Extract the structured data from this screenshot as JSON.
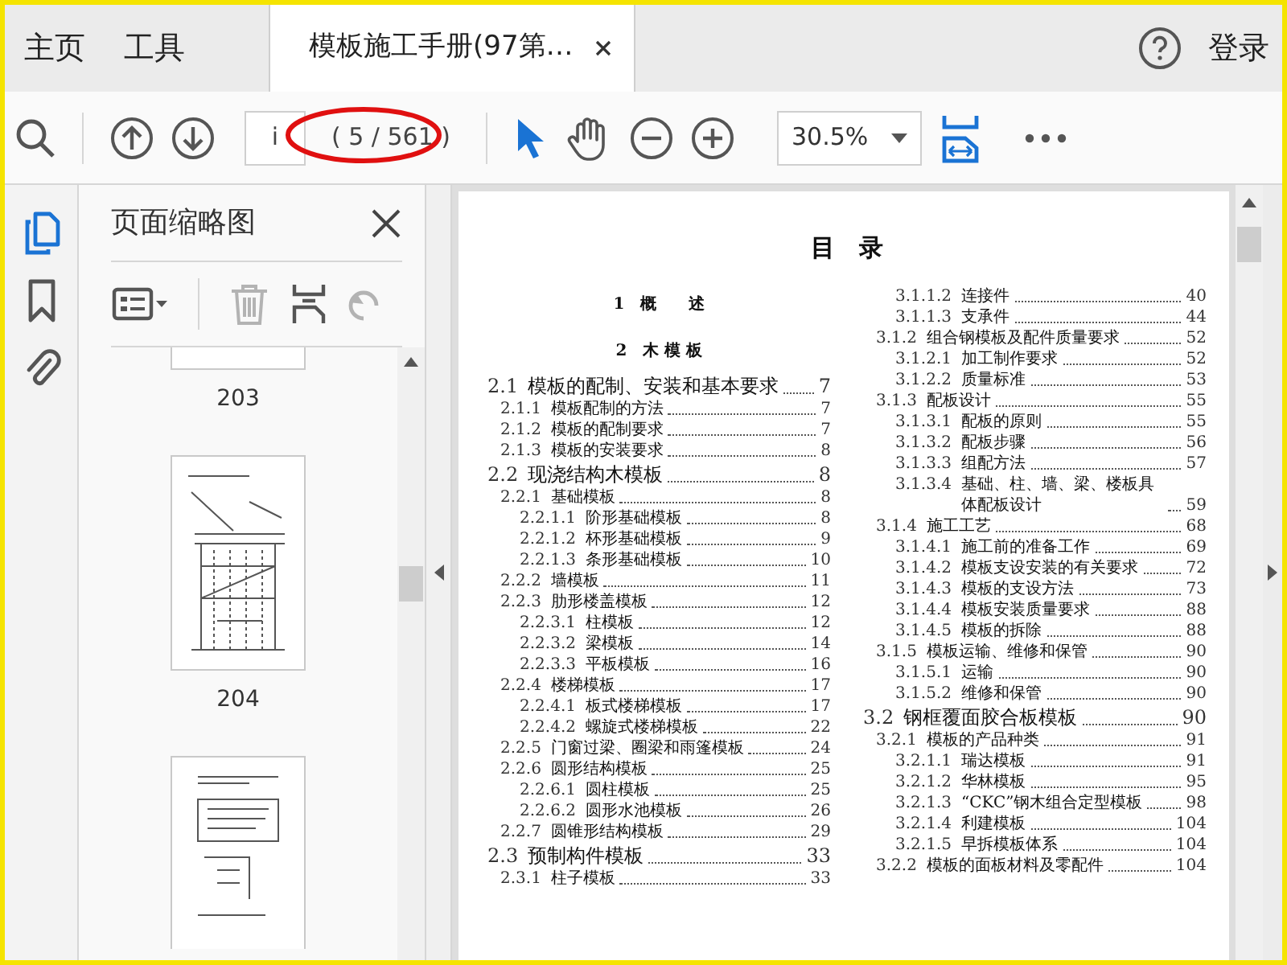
{
  "tabs": [
    {
      "label": "主页",
      "selected": false,
      "closable": false
    },
    {
      "label": "工具",
      "selected": false,
      "closable": false
    },
    {
      "label": "模板施工手册(97第…",
      "selected": true,
      "closable": true
    }
  ],
  "account": {
    "sign_in": "登录"
  },
  "toolbar": {
    "page_field": "i",
    "page_count": "( 5 / 561 )",
    "zoom": "30.5%",
    "tools": [
      {
        "kind": "select",
        "selected": true
      },
      {
        "kind": "hand",
        "selected": false
      }
    ]
  },
  "rail": [
    {
      "kind": "pages",
      "selected": true
    },
    {
      "kind": "bookmarks",
      "selected": false
    },
    {
      "kind": "attachments",
      "selected": false
    }
  ],
  "thumbnail_panel": {
    "title": "页面缩略图",
    "tools": [
      {
        "kind": "options",
        "disabled": false
      },
      {
        "kind": "delete",
        "disabled": true
      },
      {
        "kind": "insert",
        "disabled": false
      },
      {
        "kind": "rotate",
        "disabled": true
      }
    ],
    "thumbnails": [
      {
        "kind": "bottom-edge",
        "label": "203"
      },
      {
        "kind": "full",
        "label": "204"
      },
      {
        "kind": "top-edge"
      }
    ]
  },
  "document": {
    "title": "目　录",
    "headings": [
      "1　概　　述",
      "2　木 模 板"
    ],
    "columns": [
      [
        {
          "number": "2.1",
          "title": "模板的配制、安装和基本要求",
          "page": "7",
          "children": [
            {
              "number": "2.1.1",
              "title": "模板配制的方法",
              "page": "7"
            },
            {
              "number": "2.1.2",
              "title": "模板的配制要求",
              "page": "7"
            },
            {
              "number": "2.1.3",
              "title": "模板的安装要求",
              "page": "8"
            }
          ]
        },
        {
          "number": "2.2",
          "title": "现浇结构木模板",
          "page": "8",
          "children": [
            {
              "number": "2.2.1",
              "title": "基础模板",
              "page": "8",
              "children": [
                {
                  "number": "2.2.1.1",
                  "title": "阶形基础模板",
                  "page": "8"
                },
                {
                  "number": "2.2.1.2",
                  "title": "杯形基础模板",
                  "page": "9"
                },
                {
                  "number": "2.2.1.3",
                  "title": "条形基础模板",
                  "page": "10"
                }
              ]
            },
            {
              "number": "2.2.2",
              "title": "墙模板",
              "page": "11"
            },
            {
              "number": "2.2.3",
              "title": "肋形楼盖模板",
              "page": "12",
              "children": [
                {
                  "number": "2.2.3.1",
                  "title": "柱模板",
                  "page": "12"
                },
                {
                  "number": "2.2.3.2",
                  "title": "梁模板",
                  "page": "14"
                },
                {
                  "number": "2.2.3.3",
                  "title": "平板模板",
                  "page": "16"
                }
              ]
            },
            {
              "number": "2.2.4",
              "title": "楼梯模板",
              "page": "17",
              "children": [
                {
                  "number": "2.2.4.1",
                  "title": "板式楼梯模板",
                  "page": "17"
                },
                {
                  "number": "2.2.4.2",
                  "title": "螺旋式楼梯模板",
                  "page": "22"
                }
              ]
            },
            {
              "number": "2.2.5",
              "title": "门窗过梁、圈梁和雨篷模板",
              "page": "24"
            },
            {
              "number": "2.2.6",
              "title": "圆形结构模板",
              "page": "25",
              "children": [
                {
                  "number": "2.2.6.1",
                  "title": "圆柱模板",
                  "page": "25"
                },
                {
                  "number": "2.2.6.2",
                  "title": "圆形水池模板",
                  "page": "26"
                }
              ]
            },
            {
              "number": "2.2.7",
              "title": "圆锥形结构模板",
              "page": "29"
            }
          ]
        },
        {
          "number": "2.3",
          "title": "预制构件模板",
          "page": "33",
          "children": [
            {
              "number": "2.3.1",
              "title": "柱子模板",
              "page": "33"
            }
          ]
        }
      ],
      [
        {
          "children": [
            {
              "children": [
                {
                  "number": "3.1.1.2",
                  "title": "连接件",
                  "page": "40"
                },
                {
                  "number": "3.1.1.3",
                  "title": "支承件",
                  "page": "44"
                }
              ]
            },
            {
              "number": "3.1.2",
              "title": "组合钢模板及配件质量要求",
              "page": "52",
              "children": [
                {
                  "number": "3.1.2.1",
                  "title": "加工制作要求",
                  "page": "52"
                },
                {
                  "number": "3.1.2.2",
                  "title": "质量标准",
                  "page": "53"
                }
              ]
            },
            {
              "number": "3.1.3",
              "title": "配板设计",
              "page": "55",
              "children": [
                {
                  "number": "3.1.3.1",
                  "title": "配板的原则",
                  "page": "55"
                },
                {
                  "number": "3.1.3.2",
                  "title": "配板步骤",
                  "page": "56"
                },
                {
                  "number": "3.1.3.3",
                  "title": "组配方法",
                  "page": "57"
                },
                {
                  "number": "3.1.3.4",
                  "title": "基础、柱、墙、梁、楼板具体配板设计",
                  "page": "59"
                }
              ]
            },
            {
              "number": "3.1.4",
              "title": "施工工艺",
              "page": "68",
              "children": [
                {
                  "number": "3.1.4.1",
                  "title": "施工前的准备工作",
                  "page": "69"
                },
                {
                  "number": "3.1.4.2",
                  "title": "模板支设安装的有关要求",
                  "page": "72"
                },
                {
                  "number": "3.1.4.3",
                  "title": "模板的支设方法",
                  "page": "73"
                },
                {
                  "number": "3.1.4.4",
                  "title": "模板安装质量要求",
                  "page": "88"
                },
                {
                  "number": "3.1.4.5",
                  "title": "模板的拆除",
                  "page": "88"
                }
              ]
            },
            {
              "number": "3.1.5",
              "title": "模板运输、维修和保管",
              "page": "90",
              "children": [
                {
                  "number": "3.1.5.1",
                  "title": "运输",
                  "page": "90"
                },
                {
                  "number": "3.1.5.2",
                  "title": "维修和保管",
                  "page": "90"
                }
              ]
            }
          ]
        },
        {
          "number": "3.2",
          "title": "钢框覆面胶合板模板",
          "page": "90",
          "children": [
            {
              "number": "3.2.1",
              "title": "模板的产品种类",
              "page": "91",
              "children": [
                {
                  "number": "3.2.1.1",
                  "title": "瑞达模板",
                  "page": "91"
                },
                {
                  "number": "3.2.1.2",
                  "title": "华林模板",
                  "page": "95"
                },
                {
                  "number": "3.2.1.3",
                  "title": "“CKC”钢木组合定型模板",
                  "page": "98"
                },
                {
                  "number": "3.2.1.4",
                  "title": "利建模板",
                  "page": "104"
                },
                {
                  "number": "3.2.1.5",
                  "title": "早拆模板体系",
                  "page": "104"
                }
              ]
            },
            {
              "number": "3.2.2",
              "title": "模板的面板材料及零配件",
              "page": "104"
            }
          ]
        }
      ]
    ]
  }
}
